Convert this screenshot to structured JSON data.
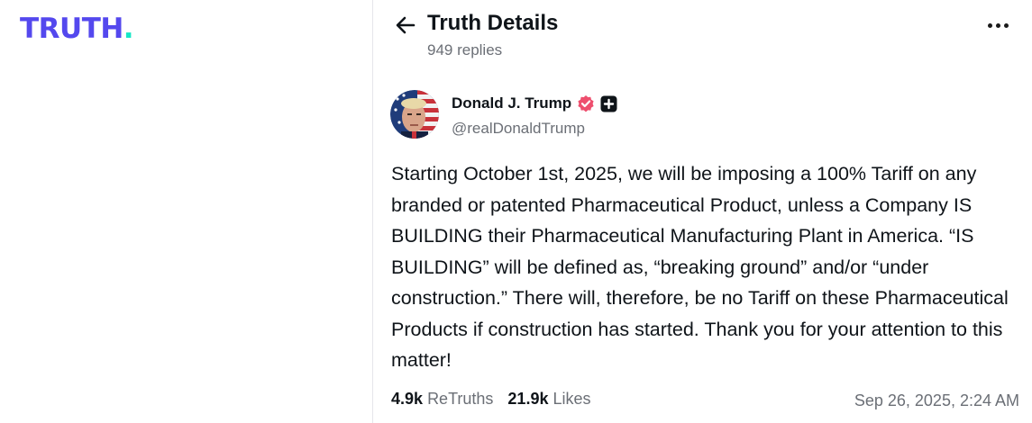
{
  "brand": {
    "logo_text": "TRUTH",
    "logo_dot": ".",
    "color_primary": "#5448ee",
    "color_accent": "#17e7c6"
  },
  "header": {
    "back_icon": "arrow-left-icon",
    "title": "Truth Details",
    "subtitle": "949 replies",
    "more_icon": "more-horizontal-icon"
  },
  "post": {
    "author_name": "Donald J. Trump",
    "verified_icon": "verified-badge-icon",
    "verified_color": "#ee4f6e",
    "plus_icon": "plus-badge-icon",
    "handle": "@realDonaldTrump",
    "text": "Starting October 1st, 2025, we will be imposing a 100% Tariff on any branded or patented Pharmaceutical Product, unless a Company IS BUILDING their Pharmaceutical Manufacturing Plant in America. “IS BUILDING” will be defined as, “breaking ground” and/or “under construction.” There will, therefore, be no Tariff on these Pharmaceutical Products if construction has started. Thank you for your attention to this matter!",
    "retruths_count": "4.9k",
    "retruths_label": "ReTruths",
    "likes_count": "21.9k",
    "likes_label": "Likes",
    "timestamp": "Sep 26, 2025, 2:24 AM"
  }
}
